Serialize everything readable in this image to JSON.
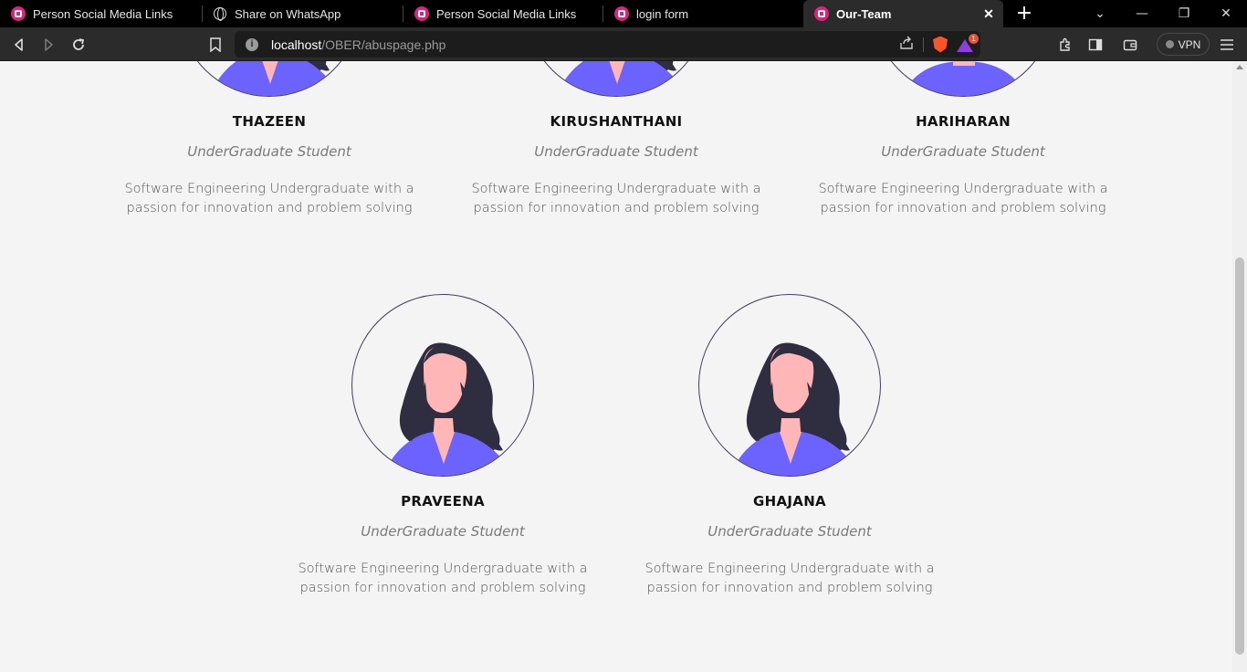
{
  "browser": {
    "tabs": [
      {
        "title": "Person Social Media Links",
        "icon": "app-favicon"
      },
      {
        "title": "Share on WhatsApp",
        "icon": "globe-icon"
      },
      {
        "title": "Person Social Media Links",
        "icon": "app-favicon"
      },
      {
        "title": "login form",
        "icon": "app-favicon"
      },
      {
        "title": "Our-Team",
        "icon": "app-favicon",
        "active": true
      }
    ],
    "url_host": "localhost",
    "url_path": "/OBER/abuspage.php",
    "rewards_badge": "1",
    "vpn_label": "VPN",
    "accent_color": "#e0217c"
  },
  "team": {
    "members": [
      {
        "name": "THAZEEN",
        "role": "UnderGraduate Student",
        "description": "Software Engineering Undergraduate with a passion for innovation and problem solving"
      },
      {
        "name": "KIRUSHANTHANI",
        "role": "UnderGraduate Student",
        "description": "Software Engineering Undergraduate with a passion for innovation and problem solving"
      },
      {
        "name": "HARIHARAN",
        "role": "UnderGraduate Student",
        "description": "Software Engineering Undergraduate with a passion for innovation and problem solving"
      },
      {
        "name": "PRAVEENA",
        "role": "UnderGraduate Student",
        "description": "Software Engineering Undergraduate with a passion for innovation and problem solving"
      },
      {
        "name": "GHAJANA",
        "role": "UnderGraduate Student",
        "description": "Software Engineering Undergraduate with a passion for innovation and problem solving"
      }
    ],
    "colors": {
      "shirt": "#6c63ff",
      "hair": "#2f2e41",
      "skin": "#ffb6b6",
      "outline": "#3f3d56"
    }
  }
}
